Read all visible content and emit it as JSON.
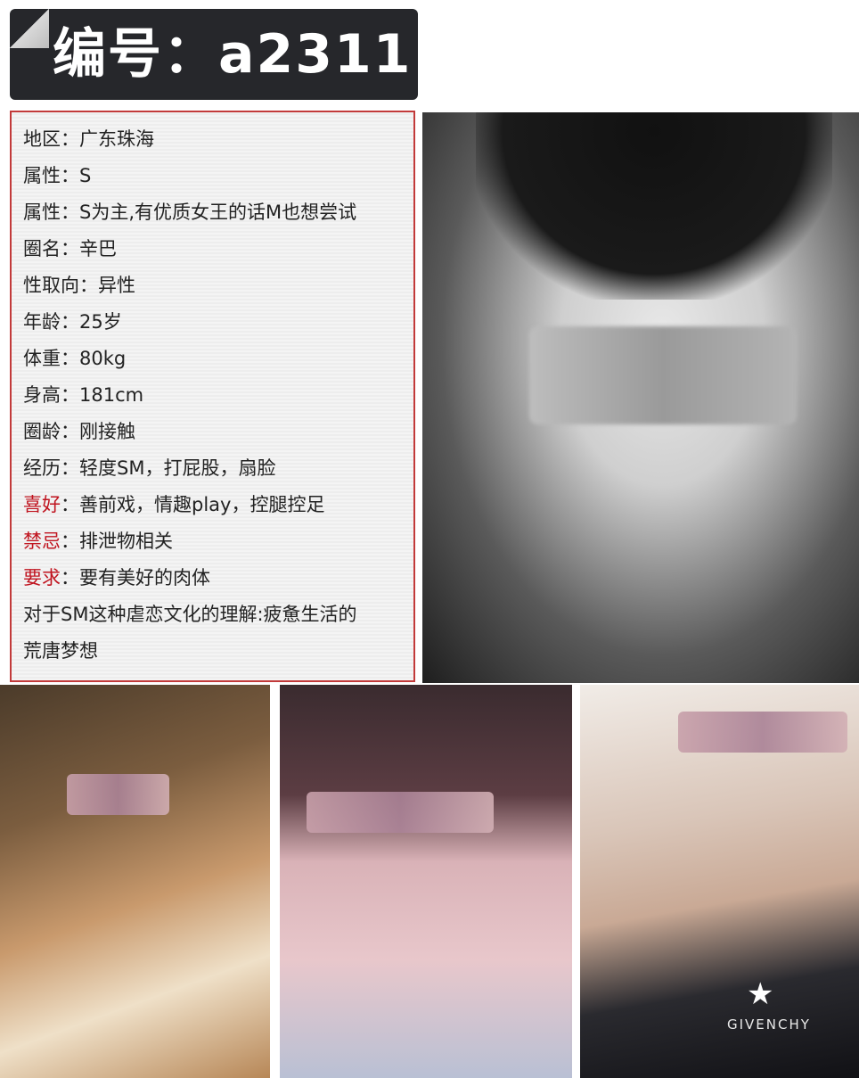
{
  "header": {
    "title": "编号：a2311"
  },
  "profile": {
    "rows": [
      {
        "key": "地区",
        "sep": "：",
        "value": "广东珠海",
        "highlight": false
      },
      {
        "key": "属性",
        "sep": "：",
        "value": "S",
        "highlight": false
      },
      {
        "key": "属性",
        "sep": "：",
        "value": "S为主,有优质女王的话M也想尝试",
        "highlight": false
      },
      {
        "key": "圈名",
        "sep": "：",
        "value": "辛巴",
        "highlight": false
      },
      {
        "key": "性取向",
        "sep": "：",
        "value": "异性",
        "highlight": false
      },
      {
        "key": "年龄",
        "sep": "：",
        "value": "25岁",
        "highlight": false
      },
      {
        "key": "体重",
        "sep": "：",
        "value": "80kg",
        "highlight": false
      },
      {
        "key": "身高",
        "sep": "：",
        "value": "181cm",
        "highlight": false
      },
      {
        "key": "圈龄",
        "sep": "：",
        "value": "刚接触",
        "highlight": false
      },
      {
        "key": "经历",
        "sep": "：",
        "value": "轻度SM，打屁股，扇脸",
        "highlight": false
      },
      {
        "key": "喜好",
        "sep": "：",
        "value": "善前戏，情趣play，控腿控足",
        "highlight": true
      },
      {
        "key": "禁忌",
        "sep": "：",
        "value": "排泄物相关",
        "highlight": true
      },
      {
        "key": "要求",
        "sep": "：",
        "value": "要有美好的肉体",
        "highlight": true
      }
    ],
    "understanding_line1": "对于SM这种虐恋文化的理解:疲惫生活的",
    "understanding_line2": "荒唐梦想"
  },
  "photos": {
    "shirt_brand": "GIVENCHY"
  },
  "colors": {
    "banner_bg": "#26272b",
    "card_border": "#c23a3a",
    "highlight_key": "#c0141f"
  }
}
